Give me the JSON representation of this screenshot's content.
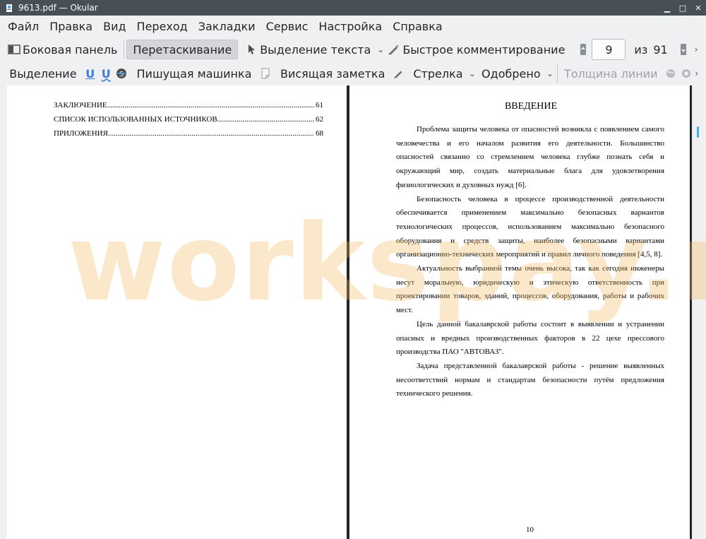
{
  "window": {
    "title": "9613.pdf  — Okular",
    "controls": [
      "minimize",
      "maximize",
      "close"
    ]
  },
  "menu": [
    "Файл",
    "Правка",
    "Вид",
    "Переход",
    "Закладки",
    "Сервис",
    "Настройка",
    "Справка"
  ],
  "toolbar1": {
    "sidebar_label": "Боковая панель",
    "drag_label": "Перетаскивание",
    "text_select_label": "Выделение текста",
    "quick_comment_label": "Быстрое комментирование",
    "page_current": "9",
    "page_of": "из",
    "page_total": "91"
  },
  "toolbar2": {
    "selection_label": "Выделение",
    "typewriter_label": "Пишущая машинка",
    "sticky_note_label": "Висящая заметка",
    "arrow_label": "Стрелка",
    "approved_label": "Одобрено",
    "line_width_label": "Толщина линии"
  },
  "left_page": {
    "toc": [
      {
        "title": "ЗАКЛЮЧЕНИЕ",
        "page": "61"
      },
      {
        "title": "СПИСОК ИСПОЛЬЗОВАННЫХ ИСТОЧНИКОВ",
        "page": "62"
      },
      {
        "title": "ПРИЛОЖЕНИЯ",
        "page": "68"
      }
    ]
  },
  "right_page": {
    "heading": "ВВЕДЕНИЕ",
    "paragraphs": [
      "Проблема защиты человека от опасностей возникла с появлением самого человечества и его началом развития его деятельности. Большинство опасностей связанно со стремлением человека глубже познать себя и окружающий мир, создать материальные блага для удовлетворения физиологических и духовных нужд [6].",
      "Безопасность человека в процессе производственной деятельности обеспечивается применением максимально безопасных вариантов технологических процессов, использованием максимально безопасного оборудования и средств защиты, наиболее безопасными вариантами организационно-технических мероприятий и правил личного поведения [4,5, 8].",
      "Актуальность выбранной темы очень высока, так как сегодня инженеры несут моральную, юридическую и этическую ответственность при проектировании товаров, зданий, процессов, оборудования, работы и рабочих мест.",
      "Цель данной бакалаврской работы состоит в выявлении и устранении опасных и вредных производственных факторов в 22 цехе прессового производства ПАО \"АВТОВАЗ\".",
      "Задача представленной бакалаврской работы - решение выявленных несоответствий нормам и стандартам безопасности путём предложения технического решения."
    ],
    "page_number": "10"
  },
  "watermark": "workspay.ru"
}
